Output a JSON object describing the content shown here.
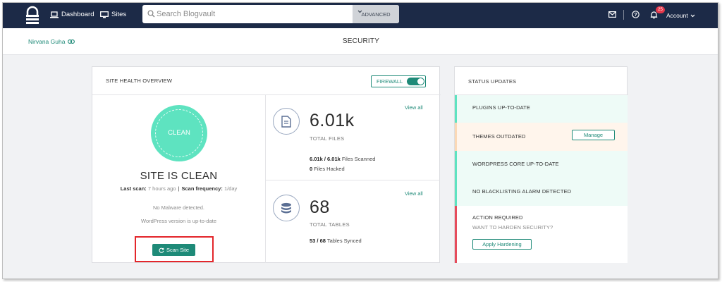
{
  "topnav": {
    "dashboard_label": "Dashboard",
    "sites_label": "Sites",
    "search_placeholder": "Search Blogvault",
    "advanced_label": "ADVANCED",
    "notification_count": "25",
    "account_label": "Account"
  },
  "subheader": {
    "site_name": "Nirvana Guha",
    "page_title": "SECURITY"
  },
  "health": {
    "title": "SITE HEALTH OVERVIEW",
    "firewall_label": "FIREWALL",
    "firewall_on": true,
    "circle_label": "CLEAN",
    "status_heading": "SITE IS CLEAN",
    "last_scan_label": "Last scan:",
    "last_scan_value": "7 hours ago",
    "scan_freq_label": "Scan frequency:",
    "scan_freq_value": "1/day",
    "malware_text": "No Malware detected.",
    "wp_version_text": "WordPress version is up-to-date",
    "scan_button": "Scan Site",
    "files": {
      "view_all": "View all",
      "big_value": "6.01k",
      "label": "TOTAL FILES",
      "scanned_value": "6.01k / 6.01k",
      "scanned_text": "Files Scanned",
      "hacked_value": "0",
      "hacked_text": "Files Hacked"
    },
    "tables": {
      "view_all": "View all",
      "big_value": "68",
      "label": "TOTAL TABLES",
      "synced_value": "53 / 68",
      "synced_text": "Tables Synced"
    }
  },
  "status_updates": {
    "title": "STATUS UPDATES",
    "plugins": "PLUGINS UP-TO-DATE",
    "themes": "THEMES OUTDATED",
    "manage_button": "Manage",
    "core": "WORDPRESS CORE UP-TO-DATE",
    "blacklist": "NO BLACKLISTING ALARM DETECTED",
    "action_required": "ACTION REQUIRED",
    "harden_question": "WANT TO HARDEN SECURITY?",
    "apply_button": "Apply Hardening"
  },
  "colors": {
    "nav_bg": "#1c2a47",
    "accent": "#1e8a78",
    "clean": "#5ee3c0",
    "warning": "#fbd9b6",
    "danger": "#e64c5c",
    "badge": "#e6384b"
  }
}
